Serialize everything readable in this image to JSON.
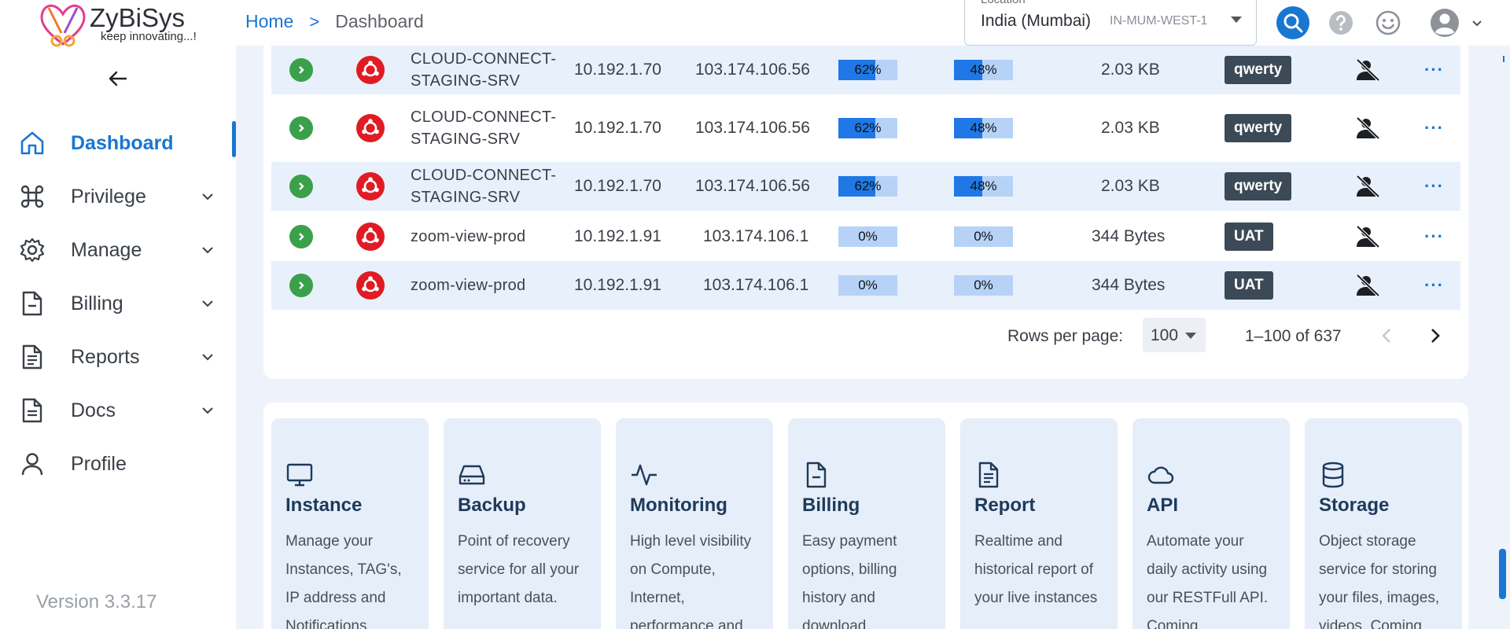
{
  "brand": {
    "name": "ZyBiSys",
    "tagline": "keep innovating...!"
  },
  "sidebar": {
    "items": [
      {
        "label": "Dashboard",
        "icon": "home-icon",
        "active": true,
        "expandable": false
      },
      {
        "label": "Privilege",
        "icon": "command-icon",
        "active": false,
        "expandable": true
      },
      {
        "label": "Manage",
        "icon": "gear-icon",
        "active": false,
        "expandable": true
      },
      {
        "label": "Billing",
        "icon": "file-minus-icon",
        "active": false,
        "expandable": true
      },
      {
        "label": "Reports",
        "icon": "file-text-icon",
        "active": false,
        "expandable": true
      },
      {
        "label": "Docs",
        "icon": "file-doc-icon",
        "active": false,
        "expandable": true
      },
      {
        "label": "Profile",
        "icon": "user-icon",
        "active": false,
        "expandable": false
      }
    ],
    "version": "Version 3.3.17"
  },
  "topbar": {
    "breadcrumb": {
      "home": "Home",
      "separator": ">",
      "current": "Dashboard"
    },
    "location": {
      "label": "Location",
      "value": "India (Mumbai)",
      "region": "IN-MUM-WEST-1"
    }
  },
  "table": {
    "rows": [
      {
        "name": "CLOUD-CONNECT-STAGING-SRV",
        "private_ip": "10.192.1.70",
        "public_ip": "103.174.106.56",
        "cpu": 62,
        "cpu_text": "62%",
        "mem": 48,
        "mem_text": "48%",
        "size": "2.03 KB",
        "tag": "qwerty"
      },
      {
        "name": "CLOUD-CONNECT-STAGING-SRV",
        "private_ip": "10.192.1.70",
        "public_ip": "103.174.106.56",
        "cpu": 62,
        "cpu_text": "62%",
        "mem": 48,
        "mem_text": "48%",
        "size": "2.03 KB",
        "tag": "qwerty"
      },
      {
        "name": "CLOUD-CONNECT-STAGING-SRV",
        "private_ip": "10.192.1.70",
        "public_ip": "103.174.106.56",
        "cpu": 62,
        "cpu_text": "62%",
        "mem": 48,
        "mem_text": "48%",
        "size": "2.03 KB",
        "tag": "qwerty"
      },
      {
        "name": "zoom-view-prod",
        "private_ip": "10.192.1.91",
        "public_ip": "103.174.106.1",
        "cpu": 0,
        "cpu_text": "0%",
        "mem": 0,
        "mem_text": "0%",
        "size": "344 Bytes",
        "tag": "UAT"
      },
      {
        "name": "zoom-view-prod",
        "private_ip": "10.192.1.91",
        "public_ip": "103.174.106.1",
        "cpu": 0,
        "cpu_text": "0%",
        "mem": 0,
        "mem_text": "0%",
        "size": "344 Bytes",
        "tag": "UAT"
      }
    ],
    "more_label": "···",
    "pagination": {
      "rows_per_page_label": "Rows per page:",
      "rows_per_page": "100",
      "range": "1–100 of 637"
    }
  },
  "services": [
    {
      "icon": "monitor-icon",
      "title": "Instance",
      "desc": "Manage your Instances, TAG's, IP address and Notifications"
    },
    {
      "icon": "hard-drive-icon",
      "title": "Backup",
      "desc": "Point of recovery service for all your important data."
    },
    {
      "icon": "activity-icon",
      "title": "Monitoring",
      "desc": "High level visibility on Compute, Internet, performance and"
    },
    {
      "icon": "file-minus-icon",
      "title": "Billing",
      "desc": "Easy payment options, billing history and download"
    },
    {
      "icon": "file-text-icon",
      "title": "Report",
      "desc": "Realtime and historical report of your live instances"
    },
    {
      "icon": "cloud-icon",
      "title": "API",
      "desc": "Automate your daily activity using our RESTFull API. Coming"
    },
    {
      "icon": "database-icon",
      "title": "Storage",
      "desc": "Object storage service for storing your files, images, videos. Coming"
    }
  ],
  "colors": {
    "accent": "#1976d2",
    "bar_fill": "#1f78e5",
    "bar_bg": "#b6d3f7",
    "tag_bg": "#3c4a57",
    "play": "#3aa04a",
    "ubuntu": "#e01b24"
  }
}
